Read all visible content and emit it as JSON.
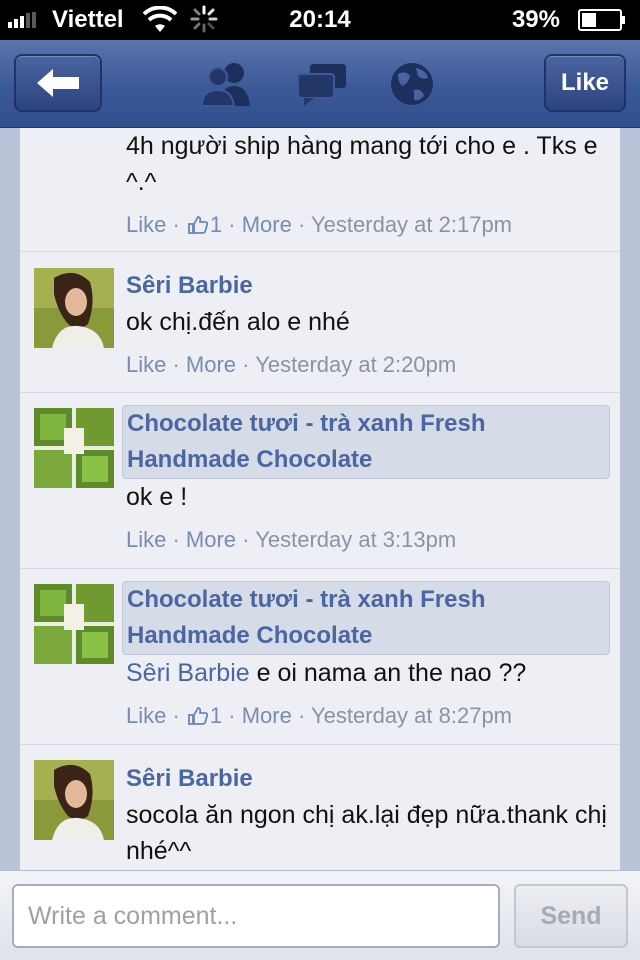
{
  "status_bar": {
    "carrier": "Viettel",
    "time": "20:14",
    "battery_percent": "39%",
    "battery_level": 0.39
  },
  "nav": {
    "back_icon": "back-arrow-icon",
    "icons": [
      "friends-icon",
      "messages-icon",
      "globe-icon"
    ],
    "like_label": "Like"
  },
  "comments": [
    {
      "author": "",
      "text": "4h người ship hàng mang tới cho e . Tks e ^.^",
      "like_label": "Like",
      "like_count": "1",
      "more_label": "More",
      "time": "Yesterday at 2:17pm"
    },
    {
      "author": "Sêri Barbie",
      "text": "ok chị.đến alo e nhé",
      "like_label": "Like",
      "more_label": "More",
      "time": "Yesterday at 2:20pm"
    },
    {
      "author": "Chocolate tươi - trà xanh Fresh Handmade Chocolate",
      "text": "ok e !",
      "like_label": "Like",
      "more_label": "More",
      "time": "Yesterday at 3:13pm"
    },
    {
      "author": "Chocolate tươi - trà xanh Fresh Handmade Chocolate",
      "tag": "Sêri Barbie",
      "text": "e oi nama an the nao ??",
      "like_label": "Like",
      "like_count": "1",
      "more_label": "More",
      "time": "Yesterday at 8:27pm"
    },
    {
      "author": "Sêri Barbie",
      "text": "socola ăn ngon chị ak.lại đẹp nữa.thank chị nhé^^"
    }
  ],
  "composer": {
    "placeholder": "Write a comment...",
    "send_label": "Send"
  },
  "colors": {
    "brand": "#3b5998",
    "link": "#4b67a1",
    "meta": "#8a93a6"
  }
}
